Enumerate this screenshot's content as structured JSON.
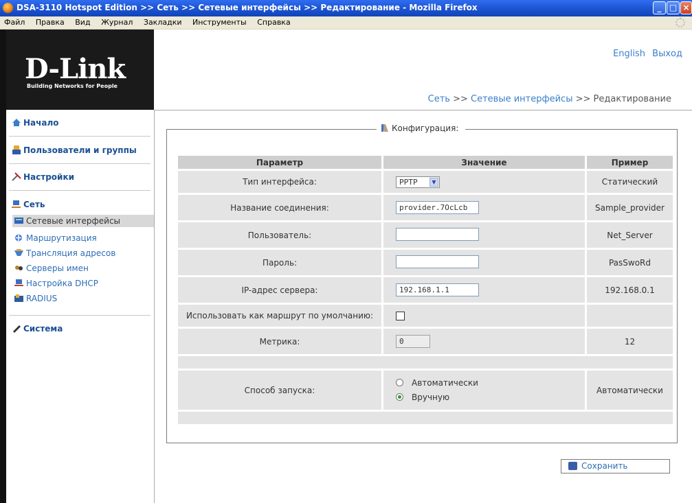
{
  "window": {
    "title": "DSA-3110 Hotspot Edition >> Сеть >> Сетевые интерфейсы >> Редактирование - Mozilla Firefox"
  },
  "menu": [
    "Файл",
    "Правка",
    "Вид",
    "Журнал",
    "Закладки",
    "Инструменты",
    "Справка"
  ],
  "header": {
    "logo": "D-Link",
    "tagline": "Building Networks for People",
    "lang_link": "English",
    "logout_link": "Выход",
    "breadcrumb": {
      "part1": "Сеть",
      "sep1": ">>",
      "part2": "Сетевые интерфейсы",
      "sep2": ">>",
      "part3": "Редактирование"
    }
  },
  "sidebar": {
    "sections": [
      "Начало",
      "Пользователи и группы",
      "Настройки",
      "Сеть",
      "Система"
    ],
    "network_items": [
      "Сетевые интерфейсы",
      "Маршрутизация",
      "Трансляция адресов",
      "Серверы имен",
      "Настройка DHCP",
      "RADIUS"
    ],
    "active_item": "Сетевые интерфейсы"
  },
  "form": {
    "legend": "Конфигурация:",
    "columns": [
      "Параметр",
      "Значение",
      "Пример"
    ],
    "rows": {
      "iface_type": {
        "label": "Тип интерфейса:",
        "value": "PPTP",
        "example": "Статический"
      },
      "conn_name": {
        "label": "Название соединения:",
        "value": "provider.7OcLcb",
        "example": "Sample_provider"
      },
      "user": {
        "label": "Пользователь:",
        "value": "",
        "example": "Net_Server"
      },
      "password": {
        "label": "Пароль:",
        "value": "",
        "example": "PasSwoRd"
      },
      "server_ip": {
        "label": "IP-адрес сервера:",
        "value": "192.168.1.1",
        "example": "192.168.0.1"
      },
      "default_route": {
        "label": "Использовать как маршрут по умолчанию:",
        "checked": false,
        "example": ""
      },
      "metric": {
        "label": "Метрика:",
        "value": "0",
        "example": "12"
      },
      "startup": {
        "label": "Способ запуска:",
        "option_auto": "Автоматически",
        "option_manual": "Вручную",
        "selected": "Вручную",
        "example": "Автоматически"
      }
    },
    "save_label": "Сохранить"
  },
  "colors": {
    "link": "#2d6db6",
    "header_bg": "#1a1a1a",
    "row_bg": "#e4e4e4",
    "th_bg": "#cfcfcf"
  }
}
